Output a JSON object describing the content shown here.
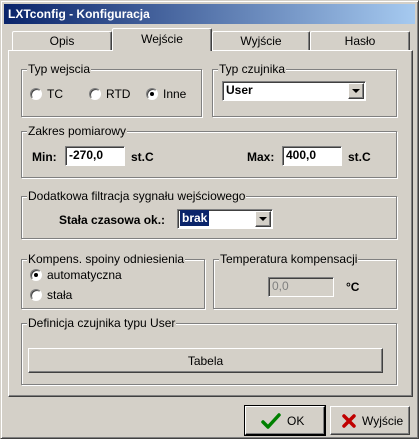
{
  "window": {
    "title": "LXTconfig - Konfiguracja"
  },
  "tabs": [
    {
      "label": "Opis",
      "active": false
    },
    {
      "label": "Wejście",
      "active": true
    },
    {
      "label": "Wyjście",
      "active": false
    },
    {
      "label": "Hasło",
      "active": false
    }
  ],
  "input_type": {
    "legend": "Typ wejscia",
    "options": [
      {
        "label": "TC",
        "selected": false
      },
      {
        "label": "RTD",
        "selected": false
      },
      {
        "label": "Inne",
        "selected": true
      }
    ]
  },
  "sensor_type": {
    "legend": "Typ czujnika",
    "value": "User"
  },
  "range": {
    "legend": "Zakres pomiarowy",
    "min_label": "Min:",
    "min_value": "-270,0",
    "min_unit": "st.C",
    "max_label": "Max:",
    "max_value": "400,0",
    "max_unit": "st.C"
  },
  "filter": {
    "legend": "Dodatkowa filtracja sygnału wejściowego",
    "label": "Stała czasowa ok.:",
    "value": "brak"
  },
  "compensation": {
    "legend": "Kompens. spoiny odniesienia",
    "options": [
      {
        "label": "automatyczna",
        "selected": true
      },
      {
        "label": "stała",
        "selected": false
      }
    ]
  },
  "comp_temp": {
    "legend": "Temperatura kompensacji",
    "value": "0,0",
    "unit": "°C"
  },
  "user_sensor": {
    "legend": "Definicja czujnika typu User",
    "button": "Tabela"
  },
  "footer": {
    "ok": "OK",
    "cancel": "Wyjście",
    "ok_icon": "check-icon",
    "cancel_icon": "x-icon",
    "ok_icon_color": "#008000",
    "cancel_icon_color": "#c00000"
  },
  "colors": {
    "title_start": "#0a246a",
    "title_end": "#a6caf0",
    "face": "#d4d0c8",
    "highlight": "#0a246a"
  }
}
